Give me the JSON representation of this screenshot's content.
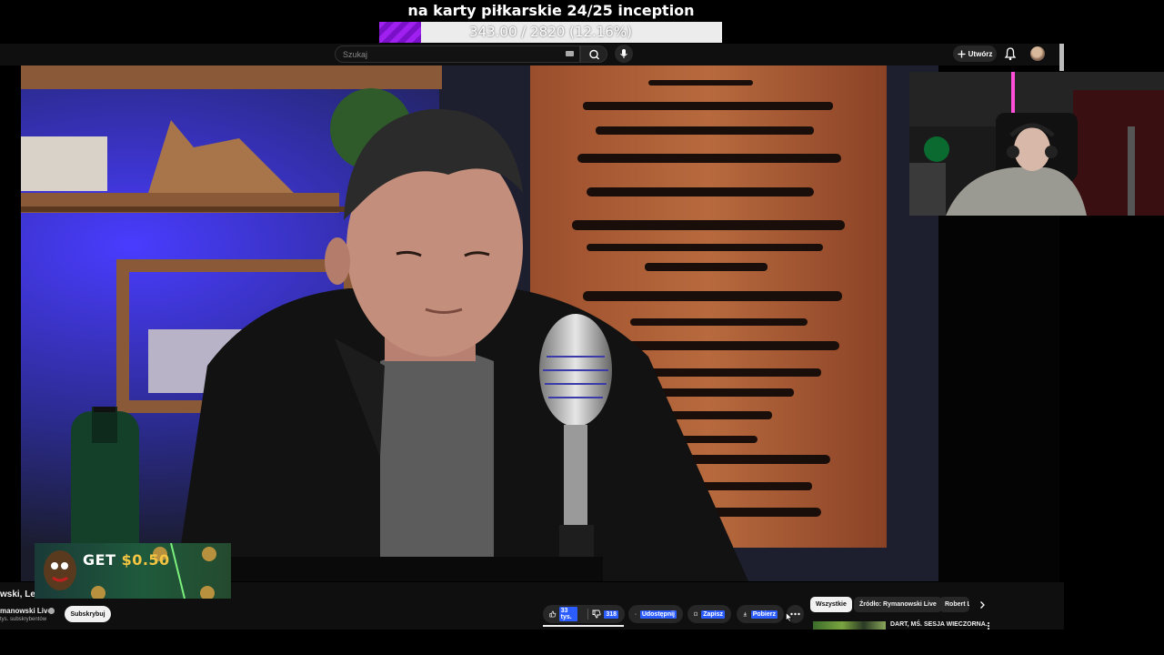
{
  "overlay": {
    "goal_title": "na karty piłkarskie 24/25 inception",
    "goal_text": "343.00 / 2820 (12.16%)",
    "goal_progress": 0.1216,
    "goal_color": "#a020f0"
  },
  "topbar": {
    "search_placeholder": "Szukaj",
    "create_label": "Utwórz"
  },
  "video_info": {
    "title": "wski, Lew",
    "channel": "manowski Live",
    "subscribers": "tys. subskrybentów",
    "subscribe_label": "Subskrybuj"
  },
  "promo": {
    "get": "GET",
    "amount": "$0.50"
  },
  "actions": {
    "likes": "33 tys.",
    "dislikes": "318",
    "share": "Udostępnij",
    "save": "Zapisz",
    "download": "Pobierz"
  },
  "chips": [
    "Wszystkie",
    "Źródło: Rymanowski Live",
    "Robert L"
  ],
  "recommendation": {
    "title": "DART, MŚ. SESJA WIECZORNA."
  },
  "colors": {
    "page_bg": "#000000",
    "panel_bg": "#0f0f0f",
    "highlight": "#2b5cff",
    "pill_bg": "#272727"
  }
}
